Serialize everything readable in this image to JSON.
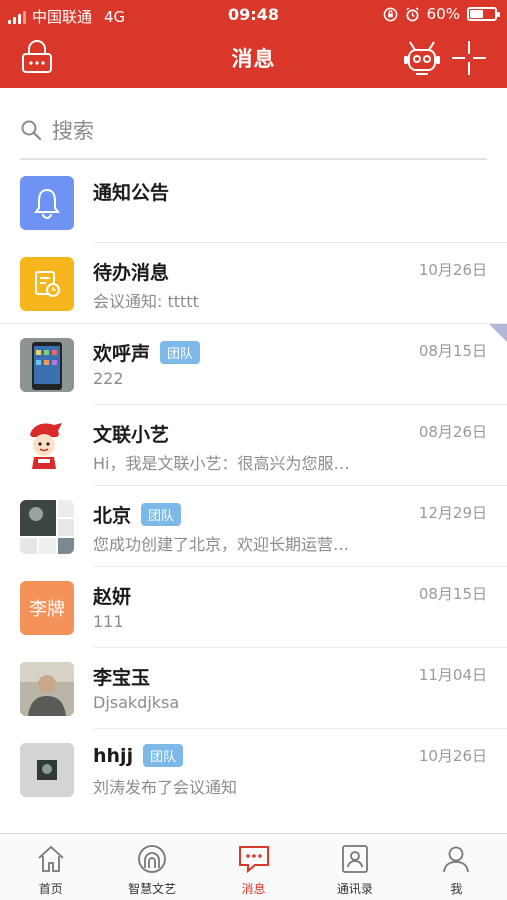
{
  "status_bar": {
    "carrier": "中国联通",
    "network": "4G",
    "time": "09:48",
    "battery_percent": "60%",
    "battery_level": 0.6
  },
  "header": {
    "title": "消息",
    "left_icon": "lock-icon",
    "right_icons": [
      "robot-icon",
      "plus-icon"
    ]
  },
  "search": {
    "placeholder": "搜索"
  },
  "conversations": [
    {
      "name": "通知公告",
      "preview": "",
      "date": "",
      "tag": "",
      "avatar": "bell-icon",
      "avatar_color": "#6f93f3"
    },
    {
      "name": "待办消息",
      "preview": "会议通知: ttttt",
      "date": "10月26日",
      "tag": "",
      "avatar": "todo-icon",
      "avatar_color": "#f7b51e"
    },
    {
      "name": "欢呼声",
      "preview": "222",
      "date": "08月15日",
      "tag": "团队",
      "avatar": "phone-photo",
      "avatar_color": "#3b4b5a"
    },
    {
      "name": "文联小艺",
      "preview": "Hi，我是文联小艺：很高兴为您服…",
      "date": "08月26日",
      "tag": "",
      "avatar": "mascot-icon",
      "avatar_color": "#ffffff"
    },
    {
      "name": "北京",
      "preview": "您成功创建了北京，欢迎长期运营…",
      "date": "12月29日",
      "tag": "团队",
      "avatar": "group-collage",
      "avatar_color": "#e8e8e8"
    },
    {
      "name": "赵妍",
      "preview": "111",
      "date": "08月15日",
      "tag": "",
      "avatar_text": "李牌",
      "avatar": "text-avatar",
      "avatar_color": "#f5925a"
    },
    {
      "name": "李宝玉",
      "preview": "Djsakdjksa",
      "date": "11月04日",
      "tag": "",
      "avatar": "person-photo",
      "avatar_color": "#8a8a80"
    },
    {
      "name": "hhjj",
      "preview": "刘涛发布了会议通知",
      "date": "10月26日",
      "tag": "团队",
      "avatar": "image-thumb",
      "avatar_color": "#d0d0d0"
    }
  ],
  "tabs": [
    {
      "label": "首页",
      "icon": "home-icon",
      "active": false
    },
    {
      "label": "智慧文艺",
      "icon": "wisdom-icon",
      "active": false
    },
    {
      "label": "消息",
      "icon": "message-icon",
      "active": true
    },
    {
      "label": "通讯录",
      "icon": "contacts-icon",
      "active": false
    },
    {
      "label": "我",
      "icon": "profile-icon",
      "active": false
    }
  ],
  "colors": {
    "brand_red": "#d9372a",
    "tag_blue": "#7cb8e8"
  }
}
